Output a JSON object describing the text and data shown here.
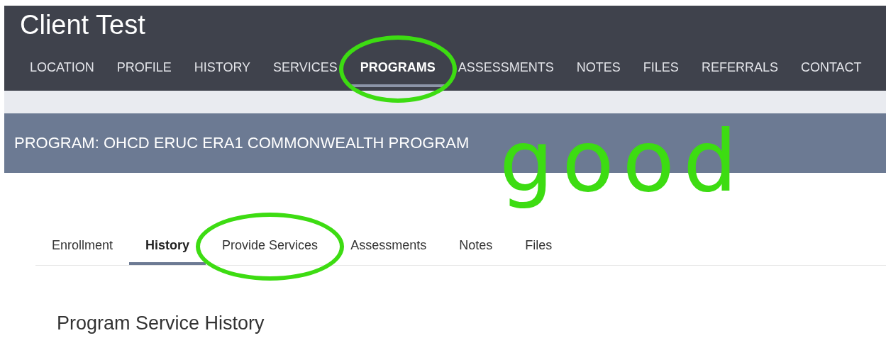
{
  "header": {
    "title": "Client Test"
  },
  "nav": [
    {
      "label": "LOCATION",
      "selected": false
    },
    {
      "label": "PROFILE",
      "selected": false
    },
    {
      "label": "HISTORY",
      "selected": false
    },
    {
      "label": "SERVICES",
      "selected": false
    },
    {
      "label": "PROGRAMS",
      "selected": true,
      "circled": true
    },
    {
      "label": "ASSESSMENTS",
      "selected": false
    },
    {
      "label": "NOTES",
      "selected": false
    },
    {
      "label": "FILES",
      "selected": false
    },
    {
      "label": "REFERRALS",
      "selected": false
    },
    {
      "label": "CONTACT",
      "selected": false
    }
  ],
  "program_bar": {
    "title": "PROGRAM: OHCD ERUC ERA1 COMMONWEALTH PROGRAM"
  },
  "tabs": [
    {
      "label": "Enrollment",
      "selected": false
    },
    {
      "label": "History",
      "selected": true
    },
    {
      "label": "Provide Services",
      "selected": false,
      "circled": true
    },
    {
      "label": "Assessments",
      "selected": false
    },
    {
      "label": "Notes",
      "selected": false
    },
    {
      "label": "Files",
      "selected": false
    }
  ],
  "section": {
    "heading": "Program Service History"
  },
  "annotations": {
    "handwriting": "good"
  }
}
